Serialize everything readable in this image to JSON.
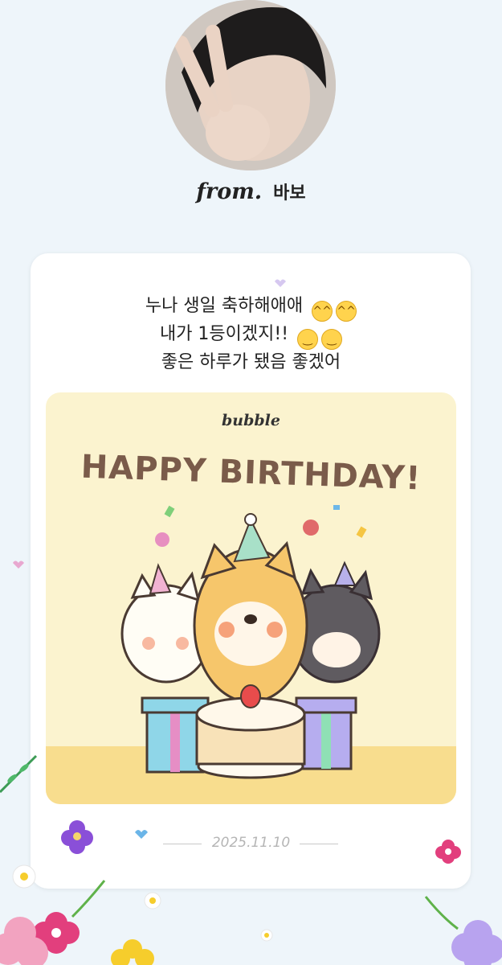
{
  "sender": {
    "from_label": "from.",
    "name": "바보"
  },
  "message": {
    "lines": [
      "누나 생일 축하해애애",
      "내가 1등이겠지!!",
      "좋은 하루가 됐음 좋겠어"
    ]
  },
  "sticker": {
    "brand": "bubble",
    "title": "HAPPY BIRTHDAY!"
  },
  "date": "2025.11.10",
  "colors": {
    "background": "#eef5fa",
    "card": "#ffffff",
    "sticker_bg": "#fbf3cf",
    "title_brown": "#7a5b4a"
  }
}
